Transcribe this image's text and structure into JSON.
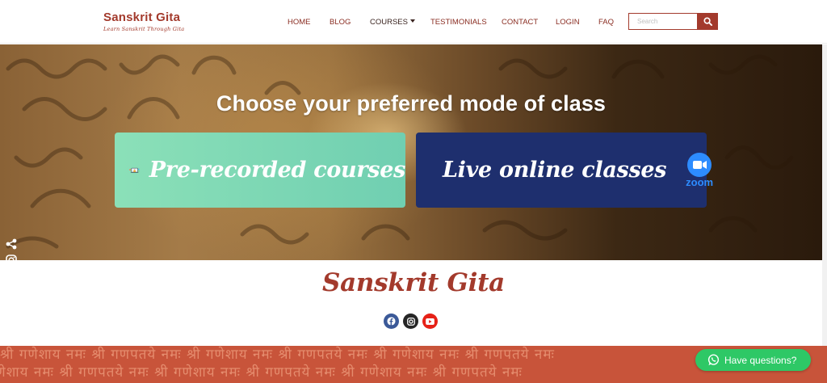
{
  "brand": {
    "title": "Sanskrit Gita",
    "tagline": "Learn Sanskrit Through Gita"
  },
  "nav": {
    "home": "HOME",
    "blog": "BLOG",
    "courses": "COURSES",
    "testimonials": "TESTIMONIALS",
    "contact": "CONTACT",
    "login": "LOGIN",
    "faq": "FAQ"
  },
  "search": {
    "placeholder": "Search",
    "icon": "search-icon"
  },
  "hero": {
    "title": "Choose your preferred mode of class",
    "prerecorded_label": "Pre-recorded courses",
    "live_label": "Live online classes",
    "zoom_label": "zoom"
  },
  "footer_brand": {
    "title": "Sanskrit Gita"
  },
  "whatsapp": {
    "label": "Have questions?"
  },
  "band_text": "श्री गणेशाय नमः श्री गणपतये नमः श्री गणेशाय नमः श्री गणपतये नमः श्री गणेशाय नमः श्री गणपतये नमः",
  "colors": {
    "brand": "#a33a2c",
    "live_card": "#1e2f6e",
    "whatsapp": "#2ec866",
    "zoom": "#2d8cff"
  }
}
